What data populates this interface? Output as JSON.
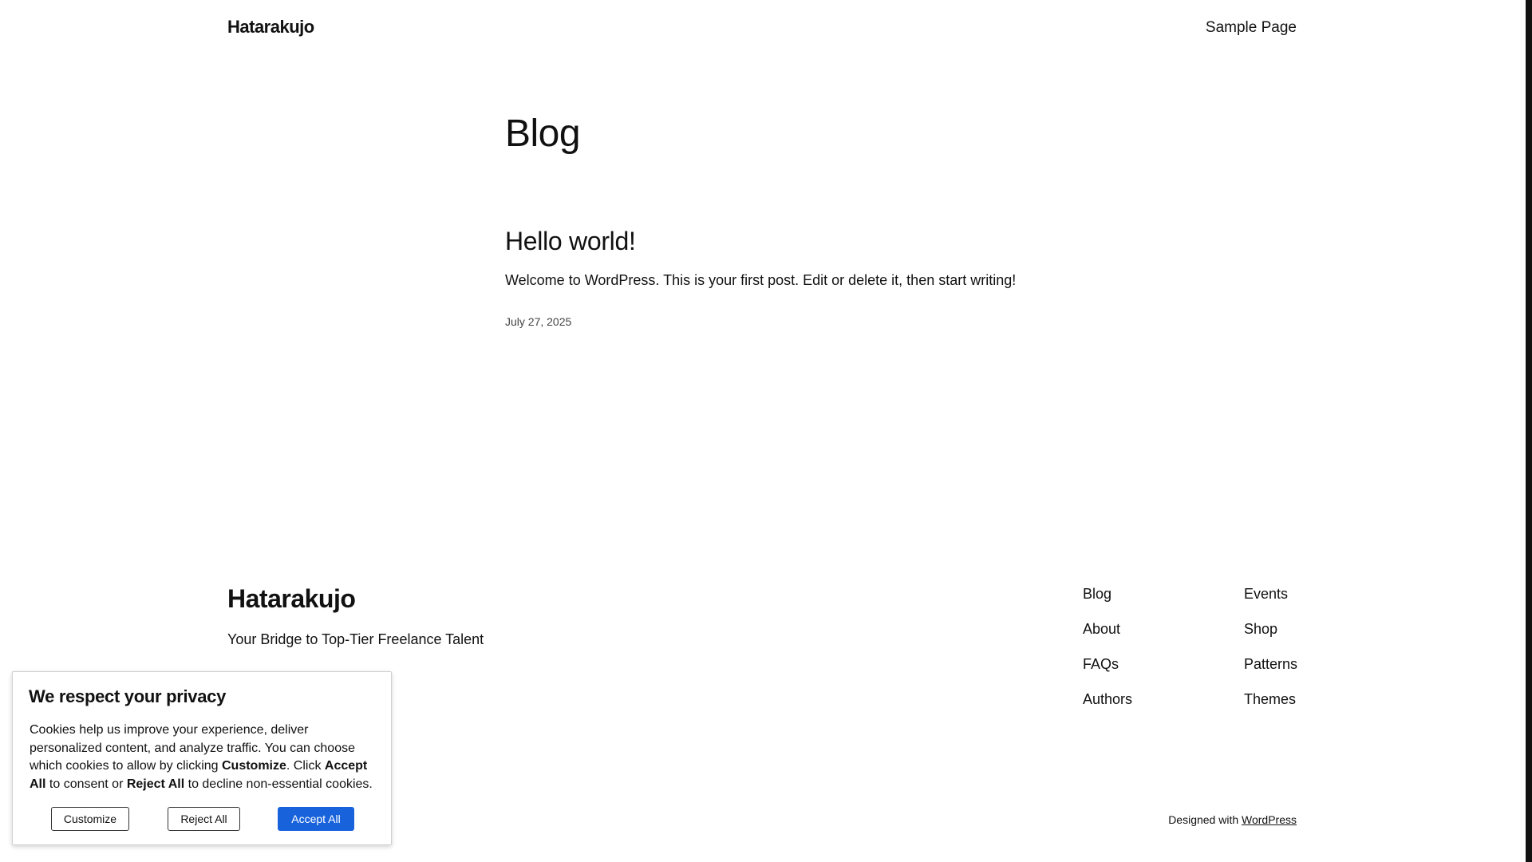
{
  "header": {
    "site_title": "Hatarakujo",
    "nav": [
      "Sample Page"
    ]
  },
  "main": {
    "page_title": "Blog",
    "posts": [
      {
        "title": "Hello world!",
        "excerpt": "Welcome to WordPress. This is your first post. Edit or delete it, then start writing!",
        "date": "July 27, 2025"
      }
    ]
  },
  "footer": {
    "site_title": "Hatarakujo",
    "tagline": "Your Bridge to Top-Tier Freelance Talent",
    "nav_col_1": [
      "Blog",
      "About",
      "FAQs",
      "Authors"
    ],
    "nav_col_2": [
      "Events",
      "Shop",
      "Patterns",
      "Themes"
    ],
    "credit_prefix": "Designed with",
    "credit_link": "WordPress"
  },
  "cookie_banner": {
    "heading": "We respect your privacy",
    "body_1": "Cookies help us improve your experience, deliver personalized content, and analyze traffic. You can choose which cookies to allow by clicking ",
    "body_customize": "Customize",
    "body_2": ". Click ",
    "body_accept": "Accept All",
    "body_3": " to consent or ",
    "body_reject": "Reject All",
    "body_4": " to decline non-essential cookies.",
    "customize_label": "Customize",
    "reject_label": "Reject All",
    "accept_label": "Accept All",
    "accept_color": "#1863dc"
  }
}
